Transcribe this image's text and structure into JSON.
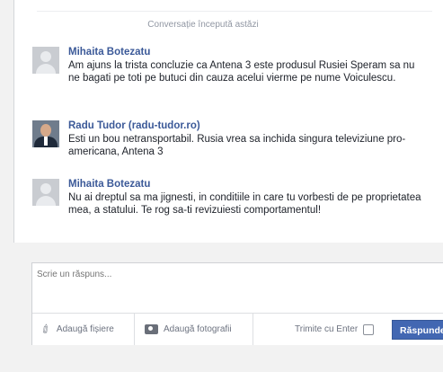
{
  "thread": {
    "started_label": "Conversație începută astăzi"
  },
  "messages": [
    {
      "sender": "Mihaita Botezatu",
      "text": "Am ajuns la trista concluzie ca Antena 3 este produsul Rusiei    Speram sa nu ne bagati pe toti pe butuci din cauza acelui vierme pe nume Voiculescu.",
      "avatar": "default-avatar-icon"
    },
    {
      "sender": "Radu Tudor (radu-tudor.ro)",
      "text": "Esti un bou netransportabil. Rusia vrea sa inchida singura televiziune pro-americana, Antena 3",
      "avatar": "profile-photo"
    },
    {
      "sender": "Mihaita Botezatu",
      "text": "Nu ai dreptul sa ma jignesti, in conditiile in care tu vorbesti de pe proprietatea mea, a statului. Te rog sa-ti revizuiesti comportamentul!",
      "avatar": "default-avatar-icon"
    }
  ],
  "composer": {
    "placeholder": "Scrie un răspuns...",
    "attach_file_label": "Adaugă fișiere",
    "add_photos_label": "Adaugă fotografii",
    "send_with_enter_label": "Trimite cu Enter",
    "send_with_enter_checked": false,
    "reply_button_label": "Răspunde"
  },
  "colors": {
    "sender_name": "#3b5998",
    "reply_button": "#4267b2",
    "background": "#f2f2f2"
  }
}
